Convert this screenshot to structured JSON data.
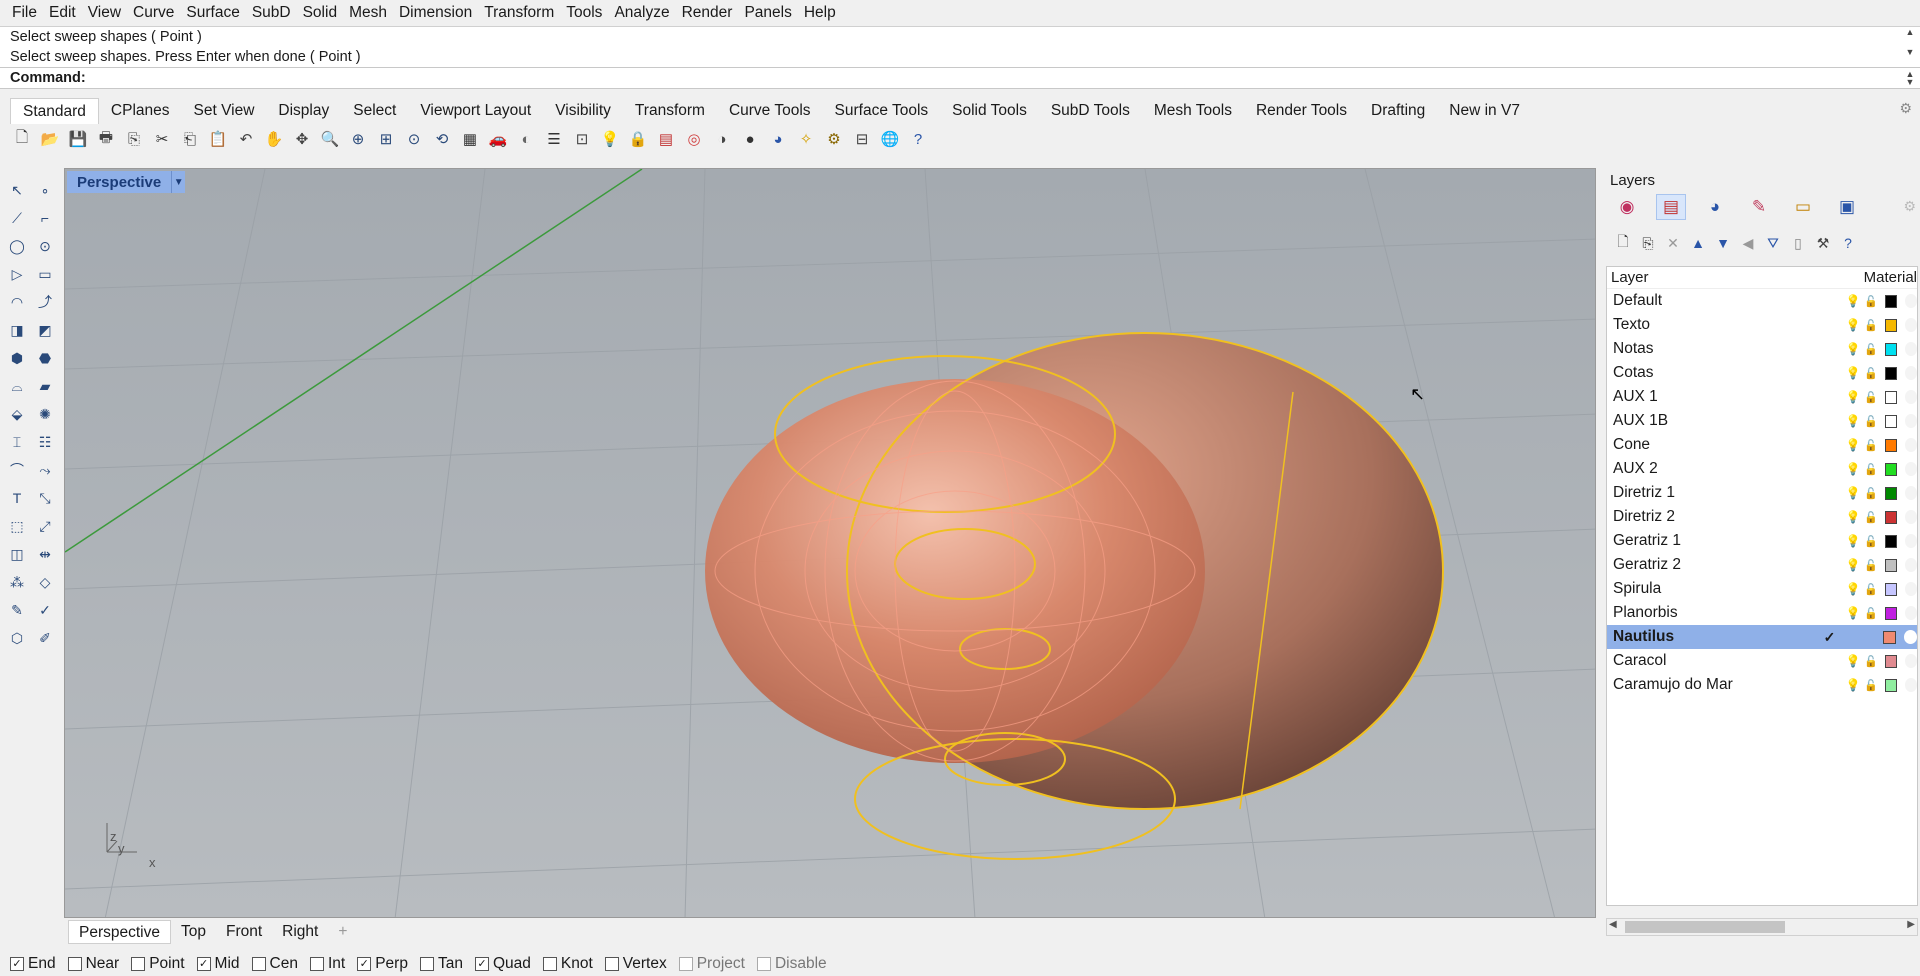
{
  "menu": [
    "File",
    "Edit",
    "View",
    "Curve",
    "Surface",
    "SubD",
    "Solid",
    "Mesh",
    "Dimension",
    "Transform",
    "Tools",
    "Analyze",
    "Render",
    "Panels",
    "Help"
  ],
  "command_history": [
    "Select sweep shapes ( Point )",
    "Select sweep shapes. Press Enter when done ( Point )"
  ],
  "command_prompt": "Command:",
  "toolbar_tabs": [
    "Standard",
    "CPlanes",
    "Set View",
    "Display",
    "Select",
    "Viewport Layout",
    "Visibility",
    "Transform",
    "Curve Tools",
    "Surface Tools",
    "Solid Tools",
    "SubD Tools",
    "Mesh Tools",
    "Render Tools",
    "Drafting",
    "New in V7"
  ],
  "active_tab": "Standard",
  "toolbar_icons": [
    "new-icon",
    "open-icon",
    "save-icon",
    "print-icon",
    "import-icon",
    "cut-icon",
    "copy-icon",
    "paste-icon",
    "undo-icon",
    "pan-icon",
    "move-view-icon",
    "zoom-icon",
    "zoom-window-icon",
    "zoom-extents-icon",
    "zoom-selected-icon",
    "rotate-view-icon",
    "four-views-icon",
    "car-icon",
    "display-mode-icon",
    "object-properties-icon",
    "cplane-icon",
    "light-icon",
    "lock-icon",
    "layer-icon",
    "color-wheel-icon",
    "shade-icon",
    "sphere-icon",
    "render-sphere-icon",
    "flashlight-icon",
    "options-icon",
    "grid-icon",
    "globe-icon",
    "help-icon"
  ],
  "viewport": {
    "title": "Perspective",
    "axis_labels": {
      "z": "z",
      "y": "y",
      "x": "x"
    }
  },
  "view_tabs": [
    "Perspective",
    "Top",
    "Front",
    "Right"
  ],
  "osnaps": [
    {
      "label": "End",
      "checked": true,
      "enabled": true
    },
    {
      "label": "Near",
      "checked": false,
      "enabled": true
    },
    {
      "label": "Point",
      "checked": false,
      "enabled": true
    },
    {
      "label": "Mid",
      "checked": true,
      "enabled": true
    },
    {
      "label": "Cen",
      "checked": false,
      "enabled": true
    },
    {
      "label": "Int",
      "checked": false,
      "enabled": true
    },
    {
      "label": "Perp",
      "checked": true,
      "enabled": true
    },
    {
      "label": "Tan",
      "checked": false,
      "enabled": true
    },
    {
      "label": "Quad",
      "checked": true,
      "enabled": true
    },
    {
      "label": "Knot",
      "checked": false,
      "enabled": true
    },
    {
      "label": "Vertex",
      "checked": false,
      "enabled": true
    },
    {
      "label": "Project",
      "checked": false,
      "enabled": false
    },
    {
      "label": "Disable",
      "checked": false,
      "enabled": false
    }
  ],
  "layers_panel": {
    "title": "Layers",
    "header": {
      "layer": "Layer",
      "material": "Material"
    },
    "rows": [
      {
        "name": "Default",
        "color": "#000000",
        "bulb": "yellow",
        "current": false
      },
      {
        "name": "Texto",
        "color": "#f5b800",
        "bulb": "yellow",
        "current": false
      },
      {
        "name": "Notas",
        "color": "#00e0f0",
        "bulb": "yellow",
        "current": false
      },
      {
        "name": "Cotas",
        "color": "#000000",
        "bulb": "yellow",
        "current": false
      },
      {
        "name": "AUX 1",
        "color": "#ffffff",
        "bulb": "blue",
        "current": false
      },
      {
        "name": "AUX 1B",
        "color": "#ffffff",
        "bulb": "blue",
        "current": false
      },
      {
        "name": "Cone",
        "color": "#ff7a00",
        "bulb": "blue",
        "current": false
      },
      {
        "name": "AUX 2",
        "color": "#22dd22",
        "bulb": "yellow",
        "current": false
      },
      {
        "name": "Diretriz 1",
        "color": "#008800",
        "bulb": "yellow",
        "current": false
      },
      {
        "name": "Diretriz 2",
        "color": "#cc3333",
        "bulb": "yellow",
        "current": false
      },
      {
        "name": "Geratriz 1",
        "color": "#000000",
        "bulb": "yellow",
        "current": false
      },
      {
        "name": "Geratriz 2",
        "color": "#c0c0c0",
        "bulb": "yellow",
        "current": false
      },
      {
        "name": "Spirula",
        "color": "#c6c6ff",
        "bulb": "yellow",
        "current": false
      },
      {
        "name": "Planorbis",
        "color": "#c020e0",
        "bulb": "yellow",
        "current": false
      },
      {
        "name": "Nautilus",
        "color": "#f08a70",
        "bulb": "none",
        "current": true
      },
      {
        "name": "Caracol",
        "color": "#e08a90",
        "bulb": "yellow",
        "current": false
      },
      {
        "name": "Caramujo do Mar",
        "color": "#90eea0",
        "bulb": "yellow",
        "current": false
      }
    ]
  }
}
